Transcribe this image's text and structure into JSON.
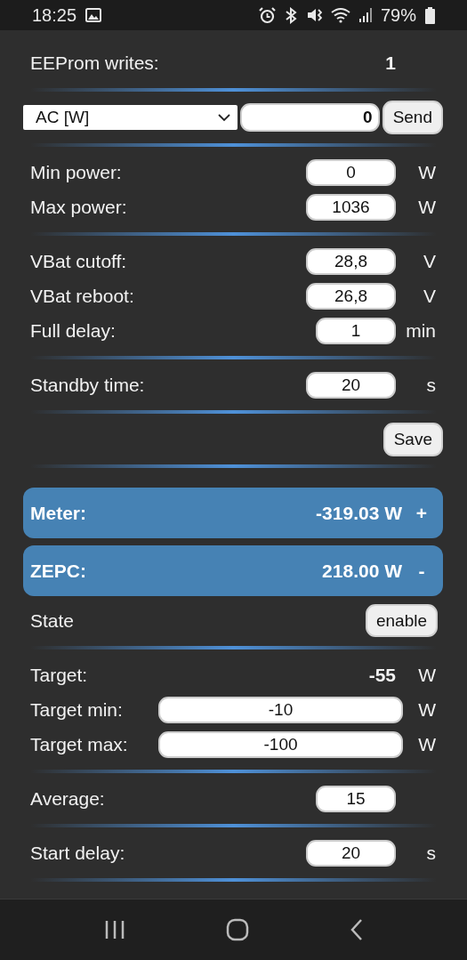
{
  "status_bar": {
    "time": "18:25",
    "battery": "79%"
  },
  "info_rows": [
    {
      "label": "EEProm writes:",
      "value": "1"
    }
  ],
  "command": {
    "select": "AC [W]",
    "value": "0",
    "button": "Send"
  },
  "settings_groups": [
    [
      {
        "kind": "field",
        "label": "Min power:",
        "value": "0",
        "unit": "W"
      },
      {
        "kind": "field",
        "label": "Max power:",
        "value": "1036",
        "unit": "W"
      }
    ],
    [
      {
        "kind": "field",
        "label": "VBat cutoff:",
        "value": "28,8",
        "unit": "V"
      },
      {
        "kind": "field",
        "label": "VBat reboot:",
        "value": "26,8",
        "unit": "V"
      },
      {
        "kind": "short",
        "label": "Full delay:",
        "value": "1",
        "unit": "min"
      }
    ],
    [
      {
        "kind": "field",
        "label": "Standby time:",
        "value": "20",
        "unit": "s"
      }
    ]
  ],
  "save_button": "Save",
  "banners": [
    {
      "label": "Meter:",
      "value": "-319.03 W",
      "toggle": "+"
    },
    {
      "label": "ZEPC:",
      "value": "218.00 W",
      "toggle": "-"
    }
  ],
  "state": {
    "label": "State",
    "button": "enable"
  },
  "control_groups": [
    [
      {
        "kind": "readout",
        "label": "Target:",
        "value": "-55",
        "unit": "W"
      },
      {
        "kind": "wide",
        "label": "Target min:",
        "value": "-10",
        "unit": "W"
      },
      {
        "kind": "wide",
        "label": "Target max:",
        "value": "-100",
        "unit": "W"
      }
    ],
    [
      {
        "kind": "short",
        "label": "Average:",
        "value": "15"
      }
    ],
    [
      {
        "kind": "field",
        "label": "Start delay:",
        "value": "20",
        "unit": "s"
      }
    ]
  ]
}
